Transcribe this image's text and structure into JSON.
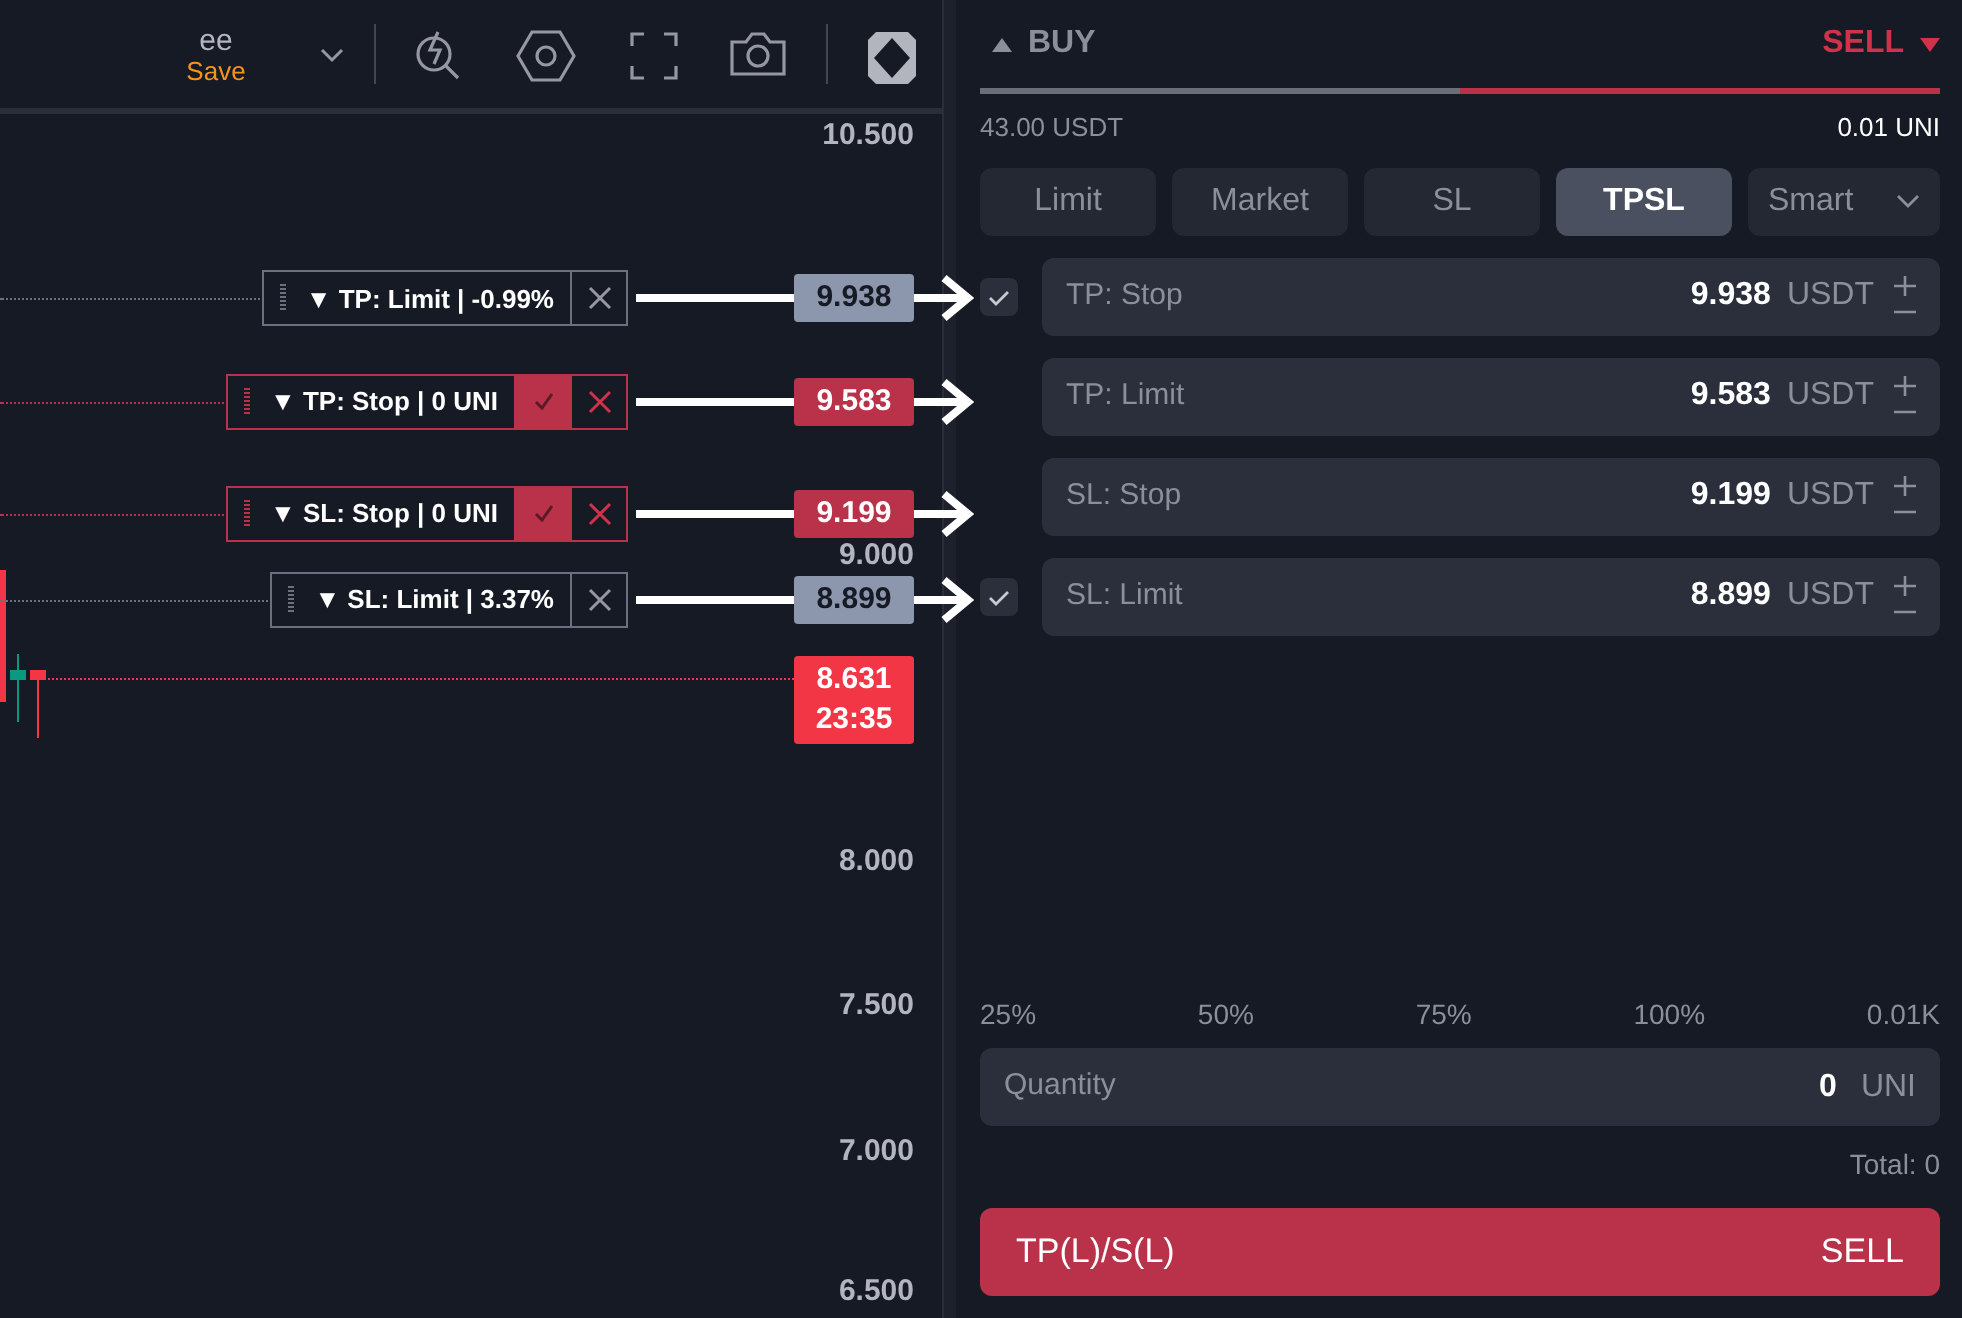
{
  "toolbar": {
    "layout_name": "ee",
    "save_label": "Save"
  },
  "price_axis": [
    {
      "text": "10.500"
    },
    {
      "text": "9.000"
    },
    {
      "text": "8.000"
    },
    {
      "text": "7.500"
    },
    {
      "text": "7.000"
    },
    {
      "text": "6.500"
    }
  ],
  "orders": [
    {
      "label": "▼ TP: Limit | -0.99%",
      "price": "9.938",
      "kind": "limit"
    },
    {
      "label": "▼ TP: Stop | 0 UNI",
      "price": "9.583",
      "kind": "stop"
    },
    {
      "label": "▼ SL: Stop | 0 UNI",
      "price": "9.199",
      "kind": "stop"
    },
    {
      "label": "▼ SL: Limit | 3.37%",
      "price": "8.899",
      "kind": "limit"
    }
  ],
  "current_price": {
    "price": "8.631",
    "countdown": "23:35"
  },
  "side_tabs": [
    {
      "label": "BUY",
      "selected": false
    },
    {
      "label": "SELL",
      "selected": true
    }
  ],
  "balances": {
    "available": "43.00 USDT",
    "position": "0.01 UNI"
  },
  "order_types": [
    {
      "label": "Limit",
      "selected": false,
      "kind": "tab"
    },
    {
      "label": "Market",
      "selected": false,
      "kind": "tab"
    },
    {
      "label": "SL",
      "selected": false,
      "kind": "tab"
    },
    {
      "label": "TPSL",
      "selected": true,
      "kind": "tab"
    },
    {
      "label": "Smart",
      "selected": false,
      "kind": "dropdown"
    }
  ],
  "tpsl_fields": [
    {
      "label": "TP: Stop",
      "value": "9.938",
      "unit": "USDT",
      "checked": true
    },
    {
      "label": "TP: Limit",
      "value": "9.583",
      "unit": "USDT",
      "checked": false
    },
    {
      "label": "SL: Stop",
      "value": "9.199",
      "unit": "USDT",
      "checked": false
    },
    {
      "label": "SL: Limit",
      "value": "8.899",
      "unit": "USDT",
      "checked": true
    }
  ],
  "percent_marks": [
    "25%",
    "50%",
    "75%",
    "100%",
    "0.01K"
  ],
  "quantity": {
    "label": "Quantity",
    "value": "0",
    "unit": "UNI"
  },
  "total": "Total: 0",
  "submit": {
    "label": "TP(L)/S(L)",
    "side": "SELL"
  }
}
